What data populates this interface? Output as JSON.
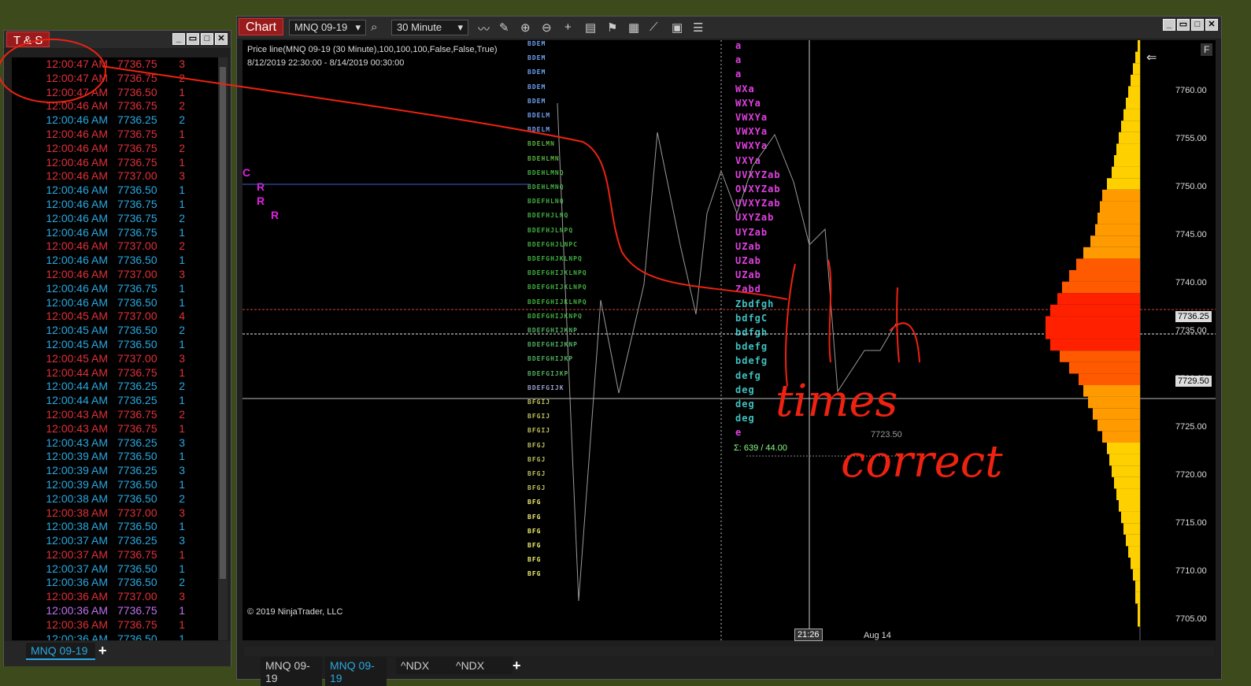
{
  "ts": {
    "title": "T & S",
    "footer_tab": "MNQ 09-19",
    "rows": [
      {
        "time": "12:00:47 AM",
        "price": "7736.75",
        "size": "3",
        "c": "red"
      },
      {
        "time": "12:00:47 AM",
        "price": "7736.75",
        "size": "2",
        "c": "red"
      },
      {
        "time": "12:00:47 AM",
        "price": "7736.50",
        "size": "1",
        "c": "red"
      },
      {
        "time": "12:00:46 AM",
        "price": "7736.75",
        "size": "2",
        "c": "red"
      },
      {
        "time": "12:00:46 AM",
        "price": "7736.25",
        "size": "2",
        "c": "blue"
      },
      {
        "time": "12:00:46 AM",
        "price": "7736.75",
        "size": "1",
        "c": "red"
      },
      {
        "time": "12:00:46 AM",
        "price": "7736.75",
        "size": "2",
        "c": "red"
      },
      {
        "time": "12:00:46 AM",
        "price": "7736.75",
        "size": "1",
        "c": "red"
      },
      {
        "time": "12:00:46 AM",
        "price": "7737.00",
        "size": "3",
        "c": "red"
      },
      {
        "time": "12:00:46 AM",
        "price": "7736.50",
        "size": "1",
        "c": "blue"
      },
      {
        "time": "12:00:46 AM",
        "price": "7736.75",
        "size": "1",
        "c": "blue"
      },
      {
        "time": "12:00:46 AM",
        "price": "7736.75",
        "size": "2",
        "c": "blue"
      },
      {
        "time": "12:00:46 AM",
        "price": "7736.75",
        "size": "1",
        "c": "blue"
      },
      {
        "time": "12:00:46 AM",
        "price": "7737.00",
        "size": "2",
        "c": "red"
      },
      {
        "time": "12:00:46 AM",
        "price": "7736.50",
        "size": "1",
        "c": "blue"
      },
      {
        "time": "12:00:46 AM",
        "price": "7737.00",
        "size": "3",
        "c": "red"
      },
      {
        "time": "12:00:46 AM",
        "price": "7736.75",
        "size": "1",
        "c": "blue"
      },
      {
        "time": "12:00:46 AM",
        "price": "7736.50",
        "size": "1",
        "c": "blue"
      },
      {
        "time": "12:00:45 AM",
        "price": "7737.00",
        "size": "4",
        "c": "red"
      },
      {
        "time": "12:00:45 AM",
        "price": "7736.50",
        "size": "2",
        "c": "blue"
      },
      {
        "time": "12:00:45 AM",
        "price": "7736.50",
        "size": "1",
        "c": "blue"
      },
      {
        "time": "12:00:45 AM",
        "price": "7737.00",
        "size": "3",
        "c": "red"
      },
      {
        "time": "12:00:44 AM",
        "price": "7736.75",
        "size": "1",
        "c": "red"
      },
      {
        "time": "12:00:44 AM",
        "price": "7736.25",
        "size": "2",
        "c": "blue"
      },
      {
        "time": "12:00:44 AM",
        "price": "7736.25",
        "size": "1",
        "c": "blue"
      },
      {
        "time": "12:00:43 AM",
        "price": "7736.75",
        "size": "2",
        "c": "red"
      },
      {
        "time": "12:00:43 AM",
        "price": "7736.75",
        "size": "1",
        "c": "red"
      },
      {
        "time": "12:00:43 AM",
        "price": "7736.25",
        "size": "3",
        "c": "blue"
      },
      {
        "time": "12:00:39 AM",
        "price": "7736.50",
        "size": "1",
        "c": "blue"
      },
      {
        "time": "12:00:39 AM",
        "price": "7736.25",
        "size": "3",
        "c": "blue"
      },
      {
        "time": "12:00:39 AM",
        "price": "7736.50",
        "size": "1",
        "c": "blue"
      },
      {
        "time": "12:00:38 AM",
        "price": "7736.50",
        "size": "2",
        "c": "blue"
      },
      {
        "time": "12:00:38 AM",
        "price": "7737.00",
        "size": "3",
        "c": "red"
      },
      {
        "time": "12:00:38 AM",
        "price": "7736.50",
        "size": "1",
        "c": "blue"
      },
      {
        "time": "12:00:37 AM",
        "price": "7736.25",
        "size": "3",
        "c": "blue"
      },
      {
        "time": "12:00:37 AM",
        "price": "7736.75",
        "size": "1",
        "c": "red"
      },
      {
        "time": "12:00:37 AM",
        "price": "7736.50",
        "size": "1",
        "c": "blue"
      },
      {
        "time": "12:00:36 AM",
        "price": "7736.50",
        "size": "2",
        "c": "blue"
      },
      {
        "time": "12:00:36 AM",
        "price": "7737.00",
        "size": "3",
        "c": "red"
      },
      {
        "time": "12:00:36 AM",
        "price": "7736.75",
        "size": "1",
        "c": "pur"
      },
      {
        "time": "12:00:36 AM",
        "price": "7736.75",
        "size": "1",
        "c": "red"
      },
      {
        "time": "12:00:36 AM",
        "price": "7736.50",
        "size": "1",
        "c": "blue"
      }
    ]
  },
  "chart": {
    "tab_label": "Chart",
    "instrument": "MNQ 09-19",
    "interval": "30 Minute",
    "indicator_line": "Price line(MNQ 09-19 (30 Minute),100,100,100,False,False,True)",
    "date_range": "8/12/2019 22:30:00 - 8/14/2019 00:30:00",
    "copyright": "© 2019 NinjaTrader, LLC",
    "f_button": "F",
    "price_labels": [
      "7760.00",
      "7755.00",
      "7750.00",
      "7745.00",
      "7740.00",
      "7735.00",
      "7730.00",
      "7725.00",
      "7720.00",
      "7715.00",
      "7710.00",
      "7705.00"
    ],
    "current_price": "7736.25",
    "marker_price": "7729.50",
    "level_label": "7723.50",
    "sigma_text": "Σ: 639 / 44.00",
    "time_cursor": "21:26",
    "date_label": "Aug 14",
    "side_letters": [
      "C",
      "R",
      "R",
      "R"
    ],
    "tpo_left": [
      "BDEM",
      "BDEM",
      "BDEM",
      "BDEM",
      "BDEM",
      "BDELM",
      "BDELM",
      "BDELMN",
      "BDEHLMN",
      "BDEHLMNQ",
      "BDEHLMNQ",
      "BDEFHLNQ",
      "BDEFHJLNQ",
      "BDEFHJLNPQ",
      "BDEFGHJLNPC",
      "BDEFGHJKLNPQ",
      "BDEFGHIJKLNPQ",
      "BDEFGHIJKLNPQ",
      "BDEFGHIJKLNPQ",
      "BDEFGHIJKNPQ",
      "BDEFGHIJKNP",
      "BDEFGHIJKNP",
      "BDEFGHIJKP",
      "BDEFGIJKP",
      "BDEFGIJK",
      "BFGIJ",
      "BFGIJ",
      "BFGIJ",
      "BFGJ",
      "BFGJ",
      "BFGJ",
      "BFGJ",
      "BFG",
      "BFG",
      "BFG",
      "BFG",
      "BFG",
      "BFG"
    ],
    "tpo_right": [
      "a",
      "a",
      "a",
      "WXa",
      "WXYa",
      "VWXYa",
      "VWXYa",
      "VWXYa",
      "VXYa",
      "UVXYZab",
      "OVXYZab",
      "UVXYZab",
      "UXYZab",
      "UYZab",
      "UZab",
      "UZab",
      "UZab",
      "Zabd",
      "Zbdfgh",
      "bdfgC",
      "bdfgh",
      "bdefg",
      "bdefg",
      "defg",
      "deg",
      "deg",
      "deg",
      "e"
    ],
    "profile_values": [
      1,
      2,
      3,
      4,
      5,
      6,
      7,
      8,
      9,
      10,
      11,
      12,
      14,
      16,
      17,
      18,
      19,
      21,
      24,
      27,
      30,
      33,
      35,
      38,
      40,
      40,
      38,
      34,
      30,
      26,
      24,
      22,
      20,
      18,
      16,
      14,
      13,
      12,
      11,
      10,
      9,
      8,
      7,
      6,
      5,
      4,
      3,
      2,
      2,
      1,
      1
    ],
    "bottom_tabs": [
      "MNQ 09-19",
      "MNQ 09-19",
      "^NDX",
      "^NDX"
    ]
  },
  "annotation": {
    "word1": "times",
    "word2": "correct"
  }
}
